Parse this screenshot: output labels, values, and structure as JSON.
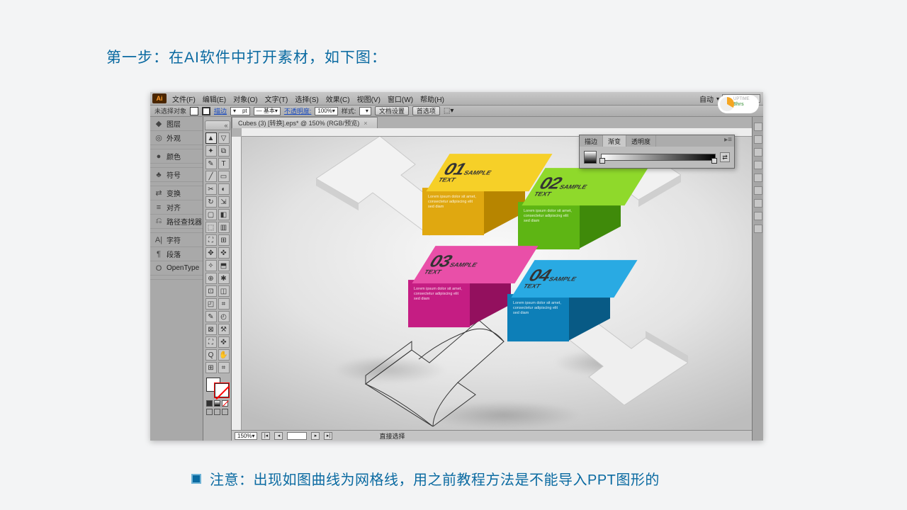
{
  "title": "第一步：在AI软件中打开素材，如下图：",
  "note": "注意：出现如图曲线为网格线，用之前教程方法是不能导入PPT图形的",
  "app": {
    "logo": "Ai",
    "menus": [
      "文件(F)",
      "编辑(E)",
      "对象(O)",
      "文字(T)",
      "选择(S)",
      "效果(C)",
      "视图(V)",
      "窗口(W)",
      "帮助(H)"
    ],
    "auto": "自动",
    "uptime_label": "UPTIME",
    "uptime_value": "8hrs"
  },
  "ctrlbar": {
    "no_selection": "未选择对象",
    "stroke": "描边",
    "pt": "pt",
    "basic": "— 基本",
    "opacity_label": "不透明度:",
    "opacity": "100%",
    "style": "样式:",
    "doc_setup": "文档设置",
    "prefs": "首选项"
  },
  "tab": "Cubes (3) [转换].eps* @ 150% (RGB/预览)",
  "left_panel": [
    {
      "icon": "◆",
      "label": "图层"
    },
    {
      "icon": "◎",
      "label": "外观"
    },
    {
      "icon": "●",
      "label": "颜色"
    },
    {
      "icon": "♣",
      "label": "符号"
    },
    {
      "icon": "⇄",
      "label": "变换"
    },
    {
      "icon": "≡",
      "label": "对齐"
    },
    {
      "icon": "⎌",
      "label": "路径查找器"
    },
    {
      "icon": "A|",
      "label": "字符"
    },
    {
      "icon": "¶",
      "label": "段落"
    },
    {
      "icon": "O",
      "label": "OpenType"
    }
  ],
  "tools": [
    "▲",
    "▽",
    "✦",
    "⧉",
    "✎",
    "T",
    "╱",
    "▭",
    "✂",
    "◐",
    "↻",
    "⇲",
    "▢",
    "◧",
    "⬚",
    "▥",
    "⛶",
    "⊞",
    "✥",
    "✜",
    "✧",
    "⬒",
    "⊕",
    "✱",
    "⊡",
    "◫",
    "◰",
    "⌗",
    "✎",
    "◴",
    "⊠",
    "⚒",
    "⛶",
    "✜",
    "Q",
    "✋",
    "⊞",
    "⌗"
  ],
  "gradient_panel": {
    "tabs": [
      "描边",
      "渐变",
      "透明度"
    ]
  },
  "status": {
    "zoom": "150%",
    "tool": "直接选择"
  },
  "cubes": [
    {
      "num": "01",
      "label": "SAMPLE TEXT",
      "top": "#f6d028",
      "front": "#e0a810",
      "side": "#b78500",
      "lorem": "Lorem ipsum dolor sit amet, consectetur adipiscing elit sed diam"
    },
    {
      "num": "02",
      "label": "SAMPLE TEXT",
      "top": "#8fd92b",
      "front": "#5eb514",
      "side": "#3f8a0a",
      "lorem": "Lorem ipsum dolor sit amet, consectetur adipiscing elit sed diam"
    },
    {
      "num": "03",
      "label": "SAMPLE TEXT",
      "top": "#e94fa8",
      "front": "#c51d83",
      "side": "#93105e",
      "lorem": "Lorem ipsum dolor sit amet, consectetur adipiscing elit sed diam"
    },
    {
      "num": "04",
      "label": "SAMPLE TEXT",
      "top": "#29aae3",
      "front": "#0d7fb8",
      "side": "#085a85",
      "lorem": "Lorem ipsum dolor sit amet, consectetur adipiscing elit sed diam"
    }
  ]
}
